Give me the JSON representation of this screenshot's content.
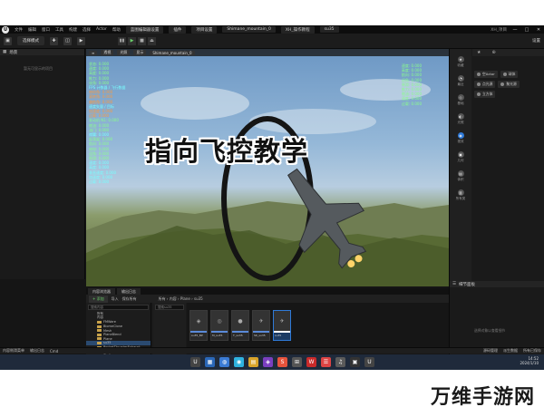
{
  "titlebar": {
    "logo": "U",
    "menus": [
      "文件",
      "编辑",
      "窗口",
      "工具",
      "构建",
      "选择",
      "Actor",
      "帮助"
    ],
    "tabs": [
      {
        "label": "蓝图编辑器设置"
      },
      {
        "label": "插件"
      },
      {
        "label": "项目设置"
      },
      {
        "label": "Shimane_mountain_0"
      },
      {
        "label": "XH_操作教程"
      },
      {
        "label": "su35"
      }
    ],
    "right_info": "XH_项目",
    "window_controls": [
      "—",
      "□",
      "✕"
    ]
  },
  "toolbar": {
    "mode": "选择模式",
    "settings": "设置",
    "play_buttons": [
      "▮▮",
      "▶",
      "■",
      "⏏"
    ]
  },
  "left_panel": {
    "title": "场景",
    "hint": "暂无可显示的项目"
  },
  "viewport": {
    "buttons": [
      "透视",
      "光照",
      "显示",
      "Shimane_mountain_0"
    ],
    "hud_left": [
      "状态: 0.000",
      "速度: 0.000",
      "高度: 0.000",
      "推力: 0.000",
      "攻角: 0.000",
      "FPS 计数器 / 飞行数据",
      "俯仰角: 0.000",
      "滚转角: 0.000",
      "偏航角: 0.000",
      "速度矢量 / 目标",
      "加速度: 0.000",
      "过载: 0.000",
      "发动机 N1: 0.000",
      "燃油: 0.000",
      "油门: 0.000",
      "襟翼: 0.000",
      "起落架: 0.000",
      "航向: 0.000",
      "俯仰: 0.000",
      "迎角: 0.000",
      "侧滑: 0.000",
      "速度: 0.000",
      "高度: 0.000",
      "垂直速度: 0.000",
      "加速度: 0.000",
      "过载: 0.000"
    ],
    "hud_right": [
      "速度: 0.000",
      "高度: 0.000",
      "航向: 0.000",
      "迎角: 0.000",
      "侧滑: 0.000",
      "推力: 0.000",
      "燃油: 0.000",
      "速度: 0.000",
      "过载: 0.000"
    ],
    "overlay_title": "指向飞控教学"
  },
  "right_panel": {
    "tabs": [
      "★",
      "⊕"
    ],
    "side_items": [
      {
        "icon": "★",
        "label": "收藏"
      },
      {
        "icon": "◔",
        "label": "最近"
      },
      {
        "icon": "◇",
        "label": "基础"
      },
      {
        "icon": "◐",
        "label": "光照"
      },
      {
        "icon": "◉",
        "label": "视效"
      },
      {
        "icon": "▣",
        "label": "几何"
      },
      {
        "icon": "▤",
        "label": "体积"
      },
      {
        "icon": "▥",
        "label": "所有类"
      }
    ],
    "buttons": [
      [
        "空Actor",
        "球体"
      ],
      [
        "点光源",
        "聚光源"
      ],
      [
        "立方体"
      ]
    ],
    "details_title": "细节面板",
    "details_hint": "选择对象以查看细节"
  },
  "content_browser": {
    "tabs": [
      "内容浏览器",
      "输出日志"
    ],
    "add_label": "+ 添加",
    "import_label": "导入",
    "save_label": "保存所有",
    "crumbs": "所有 › 内容 › Plane › su35",
    "search_placeholder": "搜索内容",
    "filter_placeholder": "搜索su35",
    "tree": [
      {
        "label": "所有",
        "selected": false
      },
      {
        "label": "内容",
        "selected": false
      },
      {
        "label": "FMWare",
        "selected": false
      },
      {
        "label": "BiomeClone",
        "selected": false
      },
      {
        "label": "Mesh",
        "selected": false
      },
      {
        "label": "PlaneBlend",
        "selected": false
      },
      {
        "label": "Plane",
        "selected": false
      },
      {
        "label": "su35",
        "selected": true
      },
      {
        "label": "RocketThrusterExhaust",
        "selected": false
      },
      {
        "label": "Sky",
        "selected": false
      },
      {
        "label": "Static",
        "selected": false
      }
    ],
    "assets": [
      {
        "icon": "◈",
        "label": "su35_BP"
      },
      {
        "icon": "◎",
        "label": "M_su35"
      },
      {
        "icon": "●",
        "label": "T_su35"
      },
      {
        "icon": "✈",
        "label": "SK_su35"
      },
      {
        "icon": "✈",
        "label": "su35",
        "selected": true
      }
    ],
    "status": "5 项(1 项被选中)"
  },
  "statusbar": {
    "left": [
      "内容侧滑菜单",
      "输出日志",
      "Cmd"
    ],
    "right": [
      "源码管理",
      "派生数据",
      "所有已保存"
    ]
  },
  "taskbar": {
    "icons": [
      "U",
      "▦",
      "◍",
      "◉",
      "▤",
      "◈",
      "S",
      "⊞",
      "W",
      "☰",
      "♫",
      "▣",
      "U"
    ],
    "time": "14:52",
    "date": "2024/1/10"
  },
  "watermark": "万维手游网",
  "colors": {
    "accent": "#2f7ad8",
    "hud_green": "#8aff8a",
    "editor_bg": "#1a1a1a"
  }
}
